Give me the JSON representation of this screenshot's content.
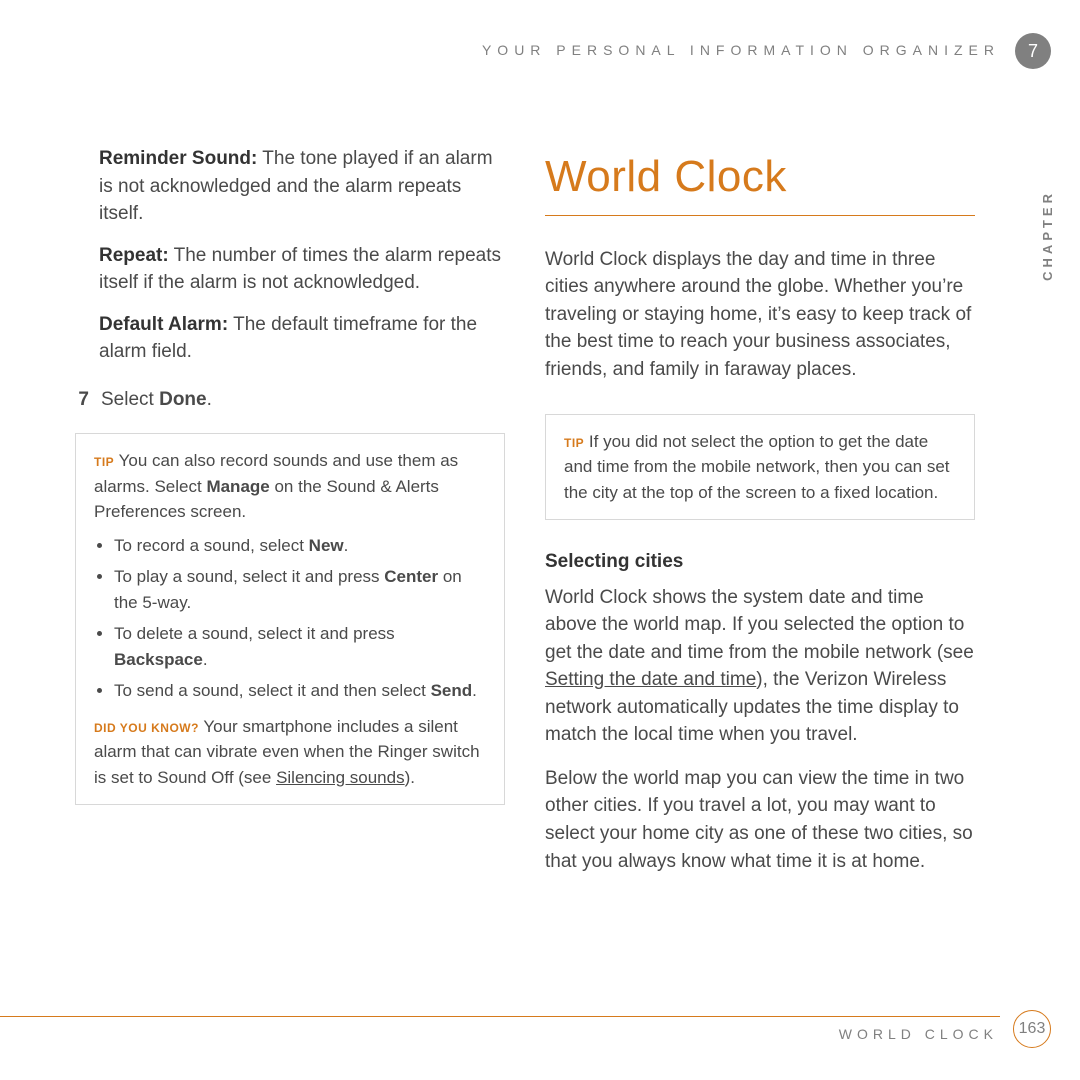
{
  "header": "YOUR PERSONAL INFORMATION ORGANIZER",
  "chapter_number": "7",
  "chapter_label": "CHAPTER",
  "left": {
    "defs": [
      {
        "term": "Reminder Sound:",
        "text": " The tone played if an alarm is not acknowledged and the alarm repeats itself."
      },
      {
        "term": "Repeat:",
        "text": " The number of times the alarm repeats itself if the alarm is not acknowledged."
      },
      {
        "term": "Default Alarm:",
        "text": " The default timeframe for the alarm field."
      }
    ],
    "step_num": "7",
    "step_text_a": "Select ",
    "step_text_b": "Done",
    "step_text_c": ".",
    "tip_label": "TIP",
    "tip_intro_a": " You can also record sounds and use them as alarms. Select ",
    "tip_intro_b": "Manage",
    "tip_intro_c": " on the Sound & Alerts Preferences screen.",
    "bullets": [
      {
        "a": "To record a sound, select ",
        "b": "New",
        "c": "."
      },
      {
        "a": "To play a sound, select it and press ",
        "b": "Center",
        "c": " on the 5-way."
      },
      {
        "a": "To delete a sound, select it and press ",
        "b": "Backspace",
        "c": "."
      },
      {
        "a": "To send a sound, select it and then select ",
        "b": "Send",
        "c": "."
      }
    ],
    "dyk_label": "DID YOU KNOW?",
    "dyk_a": " Your smartphone includes a silent alarm that can vibrate even when the Ringer switch is set to Sound Off (see ",
    "dyk_link": "Silencing sounds",
    "dyk_b": ")."
  },
  "right": {
    "title": "World Clock",
    "intro": "World Clock displays the day and time in three cities anywhere around the globe. Whether you’re traveling or staying home, it’s easy to keep track of the best time to reach your business associates, friends, and family in faraway places.",
    "tip_label": "TIP",
    "tip_text": " If you did not select the option to get the date and time from the mobile network, then you can set the city at the top of the screen to a fixed location.",
    "subhead": "Selecting cities",
    "p1_a": "World Clock shows the system date and time above the world map. If you selected the option to get the date and time from the mobile network (see ",
    "p1_link": "Setting the date and time",
    "p1_b": "), the Verizon Wireless network automatically updates the time display to match the local time when you travel.",
    "p2": "Below the world map you can view the time in two other cities. If you travel a lot, you may want to select your home city as one of these two cities, so that you always know what time it is at home."
  },
  "footer_text": "WORLD CLOCK",
  "page_number": "163"
}
